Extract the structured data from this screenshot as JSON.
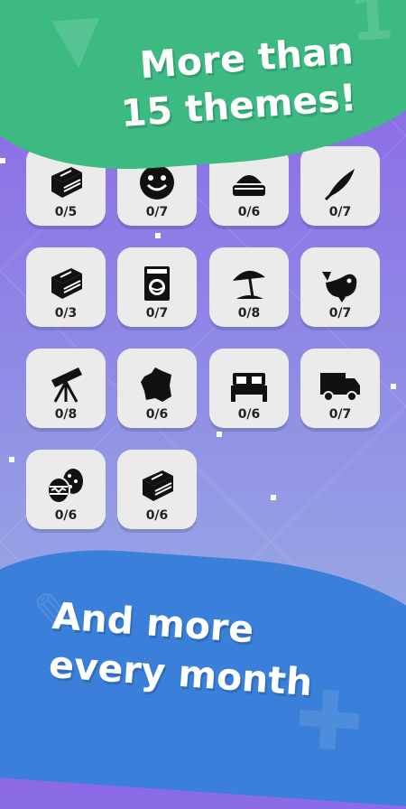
{
  "top_banner": {
    "line1": "More than",
    "line2": "15 themes!",
    "color": "#3dba82"
  },
  "bottom_banner": {
    "line1": "And more",
    "line2": "every month",
    "color": "#3a7fd9"
  },
  "themes": [
    {
      "icon": "book-icon",
      "progress": "0/5"
    },
    {
      "icon": "smiley-icon",
      "progress": "0/7"
    },
    {
      "icon": "food-tray-icon",
      "progress": "0/6"
    },
    {
      "icon": "feather-icon",
      "progress": "0/7"
    },
    {
      "icon": "book-icon",
      "progress": "0/3"
    },
    {
      "icon": "washing-machine-icon",
      "progress": "0/7"
    },
    {
      "icon": "beach-umbrella-icon",
      "progress": "0/8"
    },
    {
      "icon": "whale-icon",
      "progress": "0/7"
    },
    {
      "icon": "telescope-icon",
      "progress": "0/8"
    },
    {
      "icon": "france-map-icon",
      "progress": "0/6"
    },
    {
      "icon": "bed-icon",
      "progress": "0/6"
    },
    {
      "icon": "truck-icon",
      "progress": "0/7"
    },
    {
      "icon": "easter-eggs-icon",
      "progress": "0/6"
    },
    {
      "icon": "book-icon",
      "progress": "0/6"
    }
  ]
}
